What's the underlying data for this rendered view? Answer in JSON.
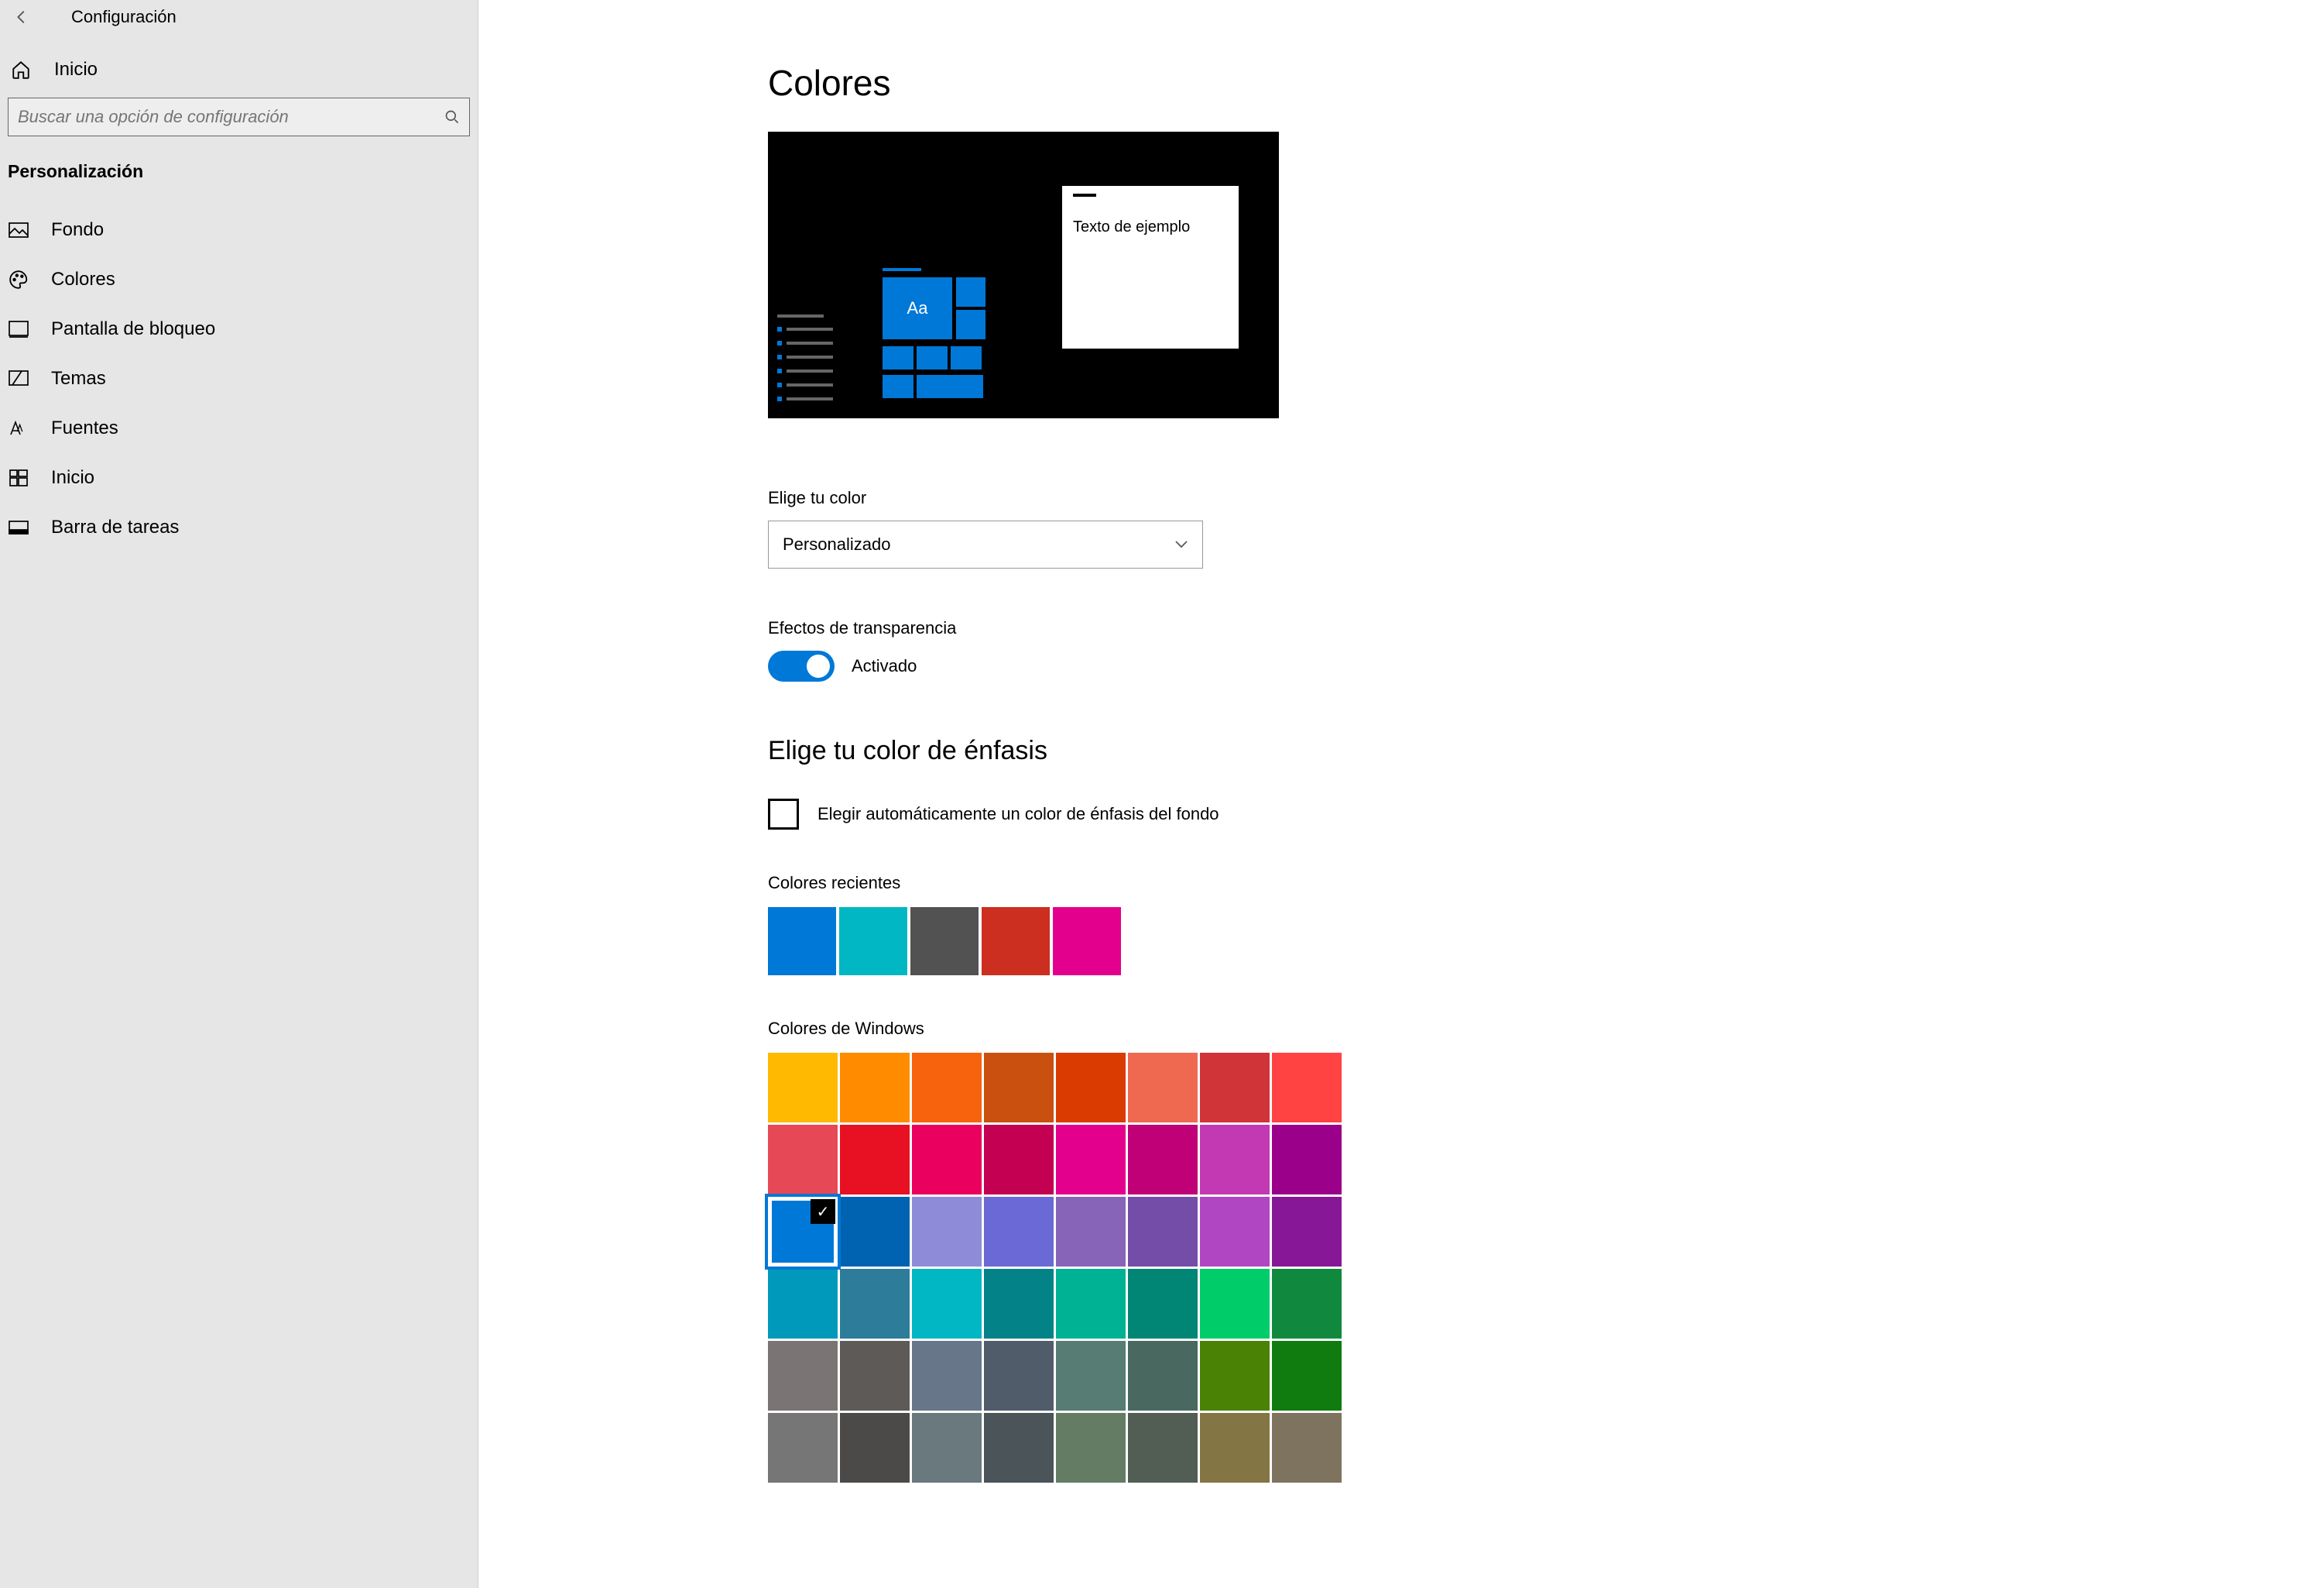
{
  "header": {
    "title": "Configuración"
  },
  "sidebar": {
    "home": "Inicio",
    "search_placeholder": "Buscar una opción de configuración",
    "section": "Personalización",
    "items": [
      {
        "label": "Fondo"
      },
      {
        "label": "Colores"
      },
      {
        "label": "Pantalla de bloqueo"
      },
      {
        "label": "Temas"
      },
      {
        "label": "Fuentes"
      },
      {
        "label": "Inicio"
      },
      {
        "label": "Barra de tareas"
      }
    ]
  },
  "page": {
    "title": "Colores",
    "preview_sample_text": "Texto de ejemplo",
    "preview_tile_text": "Aa",
    "choose_color_label": "Elige tu color",
    "mode_value": "Personalizado",
    "transparency_label": "Efectos de transparencia",
    "transparency_state": "Activado",
    "accent_heading": "Elige tu color de énfasis",
    "auto_accent_label": "Elegir automáticamente un color de énfasis del fondo",
    "recent_label": "Colores recientes",
    "recent_colors": [
      "#0078d7",
      "#00b7c3",
      "#525252",
      "#cc2e1f",
      "#e3008c"
    ],
    "windows_colors_label": "Colores de Windows",
    "windows_colors": [
      "#ffb900",
      "#ff8c00",
      "#f7630c",
      "#ca5010",
      "#da3b01",
      "#ef6950",
      "#d13438",
      "#ff4343",
      "#e74856",
      "#e81123",
      "#ea005e",
      "#c30052",
      "#e3008c",
      "#bf0077",
      "#c239b3",
      "#9a0089",
      "#0078d7",
      "#0063b1",
      "#8e8cd8",
      "#6b69d6",
      "#8764b8",
      "#744da9",
      "#b146c2",
      "#881798",
      "#0099bc",
      "#2d7d9a",
      "#00b7c3",
      "#038387",
      "#00b294",
      "#018574",
      "#00cc6a",
      "#10893e",
      "#7a7574",
      "#5d5a58",
      "#68768a",
      "#515c6b",
      "#567c73",
      "#486860",
      "#498205",
      "#107c10",
      "#767676",
      "#4c4a48",
      "#69797e",
      "#4a5459",
      "#647c64",
      "#525e54",
      "#847545",
      "#7e735f"
    ],
    "selected_windows_color_index": 16
  }
}
